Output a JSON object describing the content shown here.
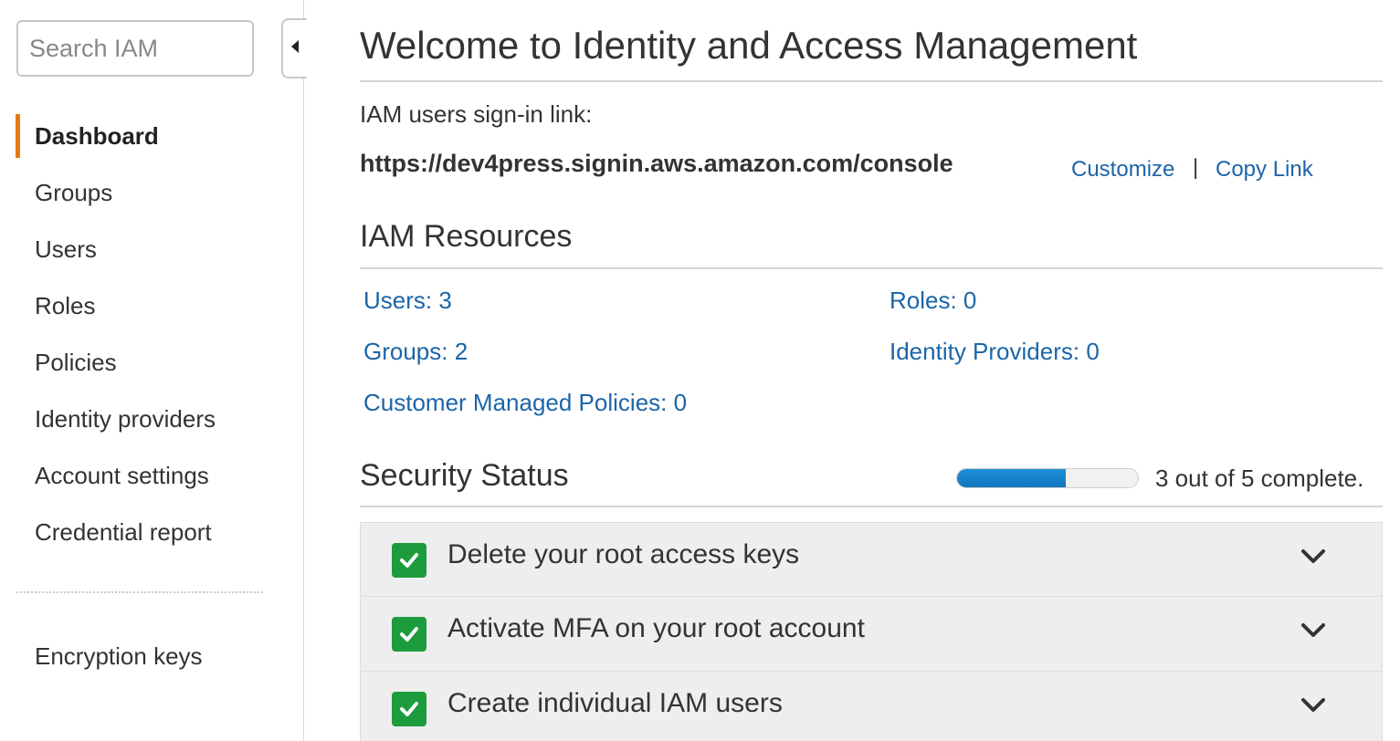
{
  "sidebar": {
    "search": {
      "placeholder": "Search IAM",
      "value": ""
    },
    "items": [
      {
        "label": "Dashboard",
        "active": true
      },
      {
        "label": "Groups"
      },
      {
        "label": "Users"
      },
      {
        "label": "Roles"
      },
      {
        "label": "Policies"
      },
      {
        "label": "Identity providers"
      },
      {
        "label": "Account settings"
      },
      {
        "label": "Credential report"
      }
    ],
    "secondary_items": [
      {
        "label": "Encryption keys"
      }
    ],
    "collapse_icon": "caret-left-icon"
  },
  "main": {
    "title": "Welcome to Identity and Access Management",
    "signin": {
      "label": "IAM users sign-in link:",
      "url": "https://dev4press.signin.aws.amazon.com/console",
      "customize_label": "Customize",
      "separator": "|",
      "copy_label": "Copy Link"
    },
    "resources": {
      "title": "IAM Resources",
      "items": [
        {
          "label": "Users: 3"
        },
        {
          "label": "Roles: 0"
        },
        {
          "label": "Groups: 2"
        },
        {
          "label": "Identity Providers: 0"
        },
        {
          "label": "Customer Managed Policies: 0"
        }
      ]
    },
    "security": {
      "title": "Security Status",
      "progress_fraction": 0.6,
      "progress_text": "3 out of 5 complete.",
      "items": [
        {
          "label": "Delete your root access keys",
          "status": "complete"
        },
        {
          "label": "Activate MFA on your root account",
          "status": "complete"
        },
        {
          "label": "Create individual IAM users",
          "status": "complete"
        }
      ]
    }
  },
  "colors": {
    "accent": "#e47911",
    "link": "#1c65a8",
    "success": "#1d9c3d",
    "progress": "#1176bd"
  }
}
